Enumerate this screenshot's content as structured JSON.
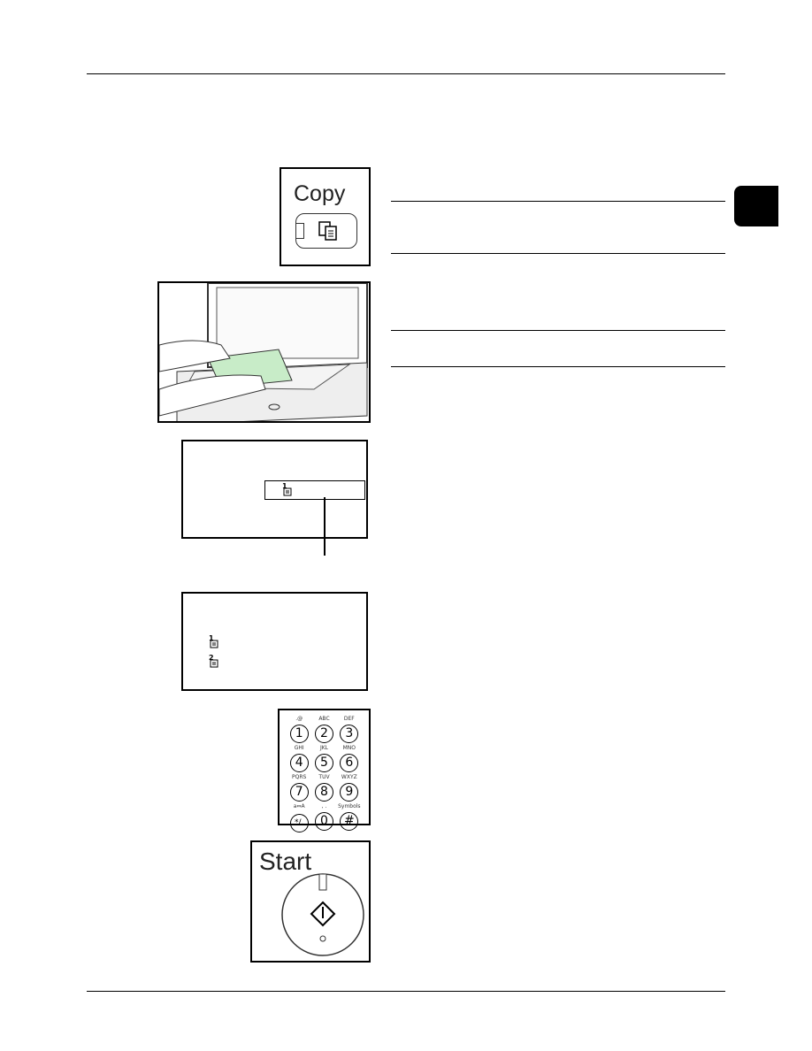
{
  "copy_key": {
    "label": "Copy",
    "icon": "copy-documents-icon"
  },
  "keypad": {
    "keys": [
      {
        "num": "1",
        "letters": ".@"
      },
      {
        "num": "2",
        "letters": "ABC"
      },
      {
        "num": "3",
        "letters": "DEF"
      },
      {
        "num": "4",
        "letters": "GHI"
      },
      {
        "num": "5",
        "letters": "JKL"
      },
      {
        "num": "6",
        "letters": "MNO"
      },
      {
        "num": "7",
        "letters": "PQRS"
      },
      {
        "num": "8",
        "letters": "TUV"
      },
      {
        "num": "9",
        "letters": "WXYZ"
      },
      {
        "num": "*/.",
        "letters": "a⇔A"
      },
      {
        "num": "0",
        "letters": ", ."
      },
      {
        "num": "#",
        "letters": "Symbols"
      }
    ]
  },
  "start_key": {
    "label": "Start",
    "icon": "start-diamond-icon"
  },
  "colors": {
    "paper": "#c8ecc8",
    "tab": "#000000"
  }
}
